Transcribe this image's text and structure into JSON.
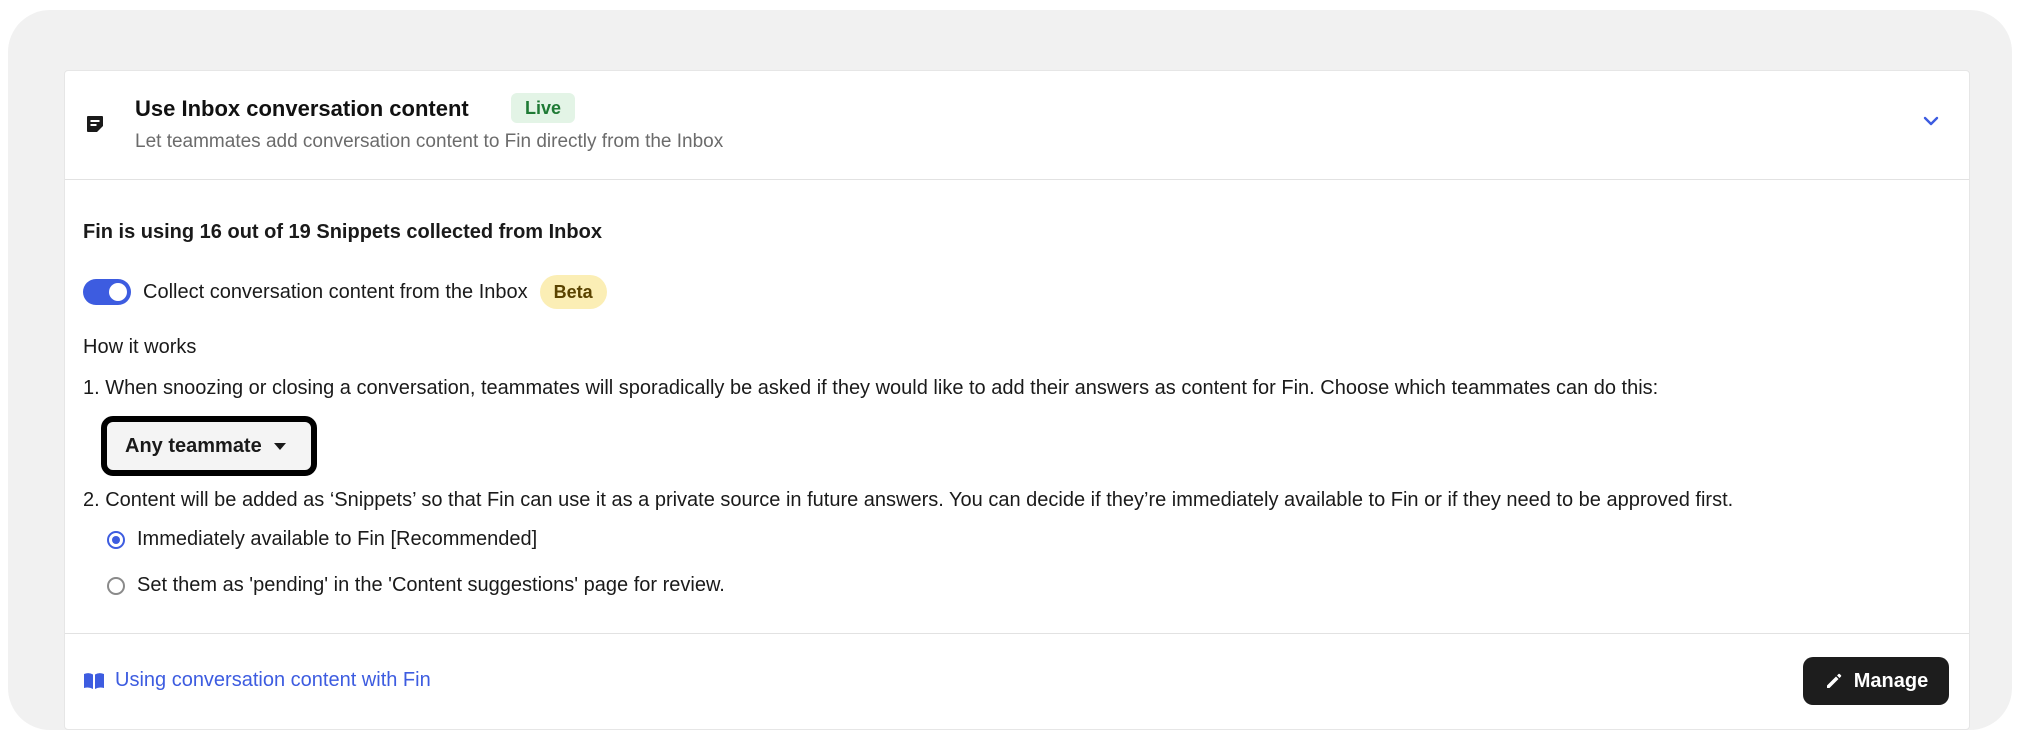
{
  "header": {
    "icon": "note-icon",
    "title": "Use Inbox conversation content",
    "live_badge": "Live",
    "subtitle": "Let teammates add conversation content to Fin directly from the Inbox",
    "chevron_icon": "chevron-down-icon"
  },
  "summary": "Fin is using 16 out of 19 Snippets collected from Inbox",
  "toggle": {
    "enabled": true,
    "label": "Collect conversation content from the Inbox",
    "beta_badge": "Beta"
  },
  "how_it_works": {
    "title": "How it works",
    "step1": "1. When snoozing or closing a conversation, teammates will sporadically be asked if they would like to add their answers as content for Fin. Choose which teammates can do this:",
    "dropdown_value": "Any teammate",
    "step2": "2. Content will be added as ‘Snippets’ so that Fin can use it as a private source in future answers. You can decide if they’re immediately available to Fin or if they need to be approved first.",
    "options": [
      {
        "label": "Immediately available to Fin [Recommended]",
        "checked": true
      },
      {
        "label": "Set them as 'pending' in the 'Content suggestions' page for review.",
        "checked": false
      }
    ]
  },
  "footer": {
    "link_icon": "book-icon",
    "link_text": "Using conversation content with Fin",
    "manage_icon": "pencil-icon",
    "manage_label": "Manage"
  },
  "colors": {
    "accent": "#3d5ce0",
    "live_bg": "#e3f4e6",
    "live_text": "#1f7a35",
    "beta_bg": "#fbeeb5",
    "button_dark": "#1d1d1d"
  }
}
